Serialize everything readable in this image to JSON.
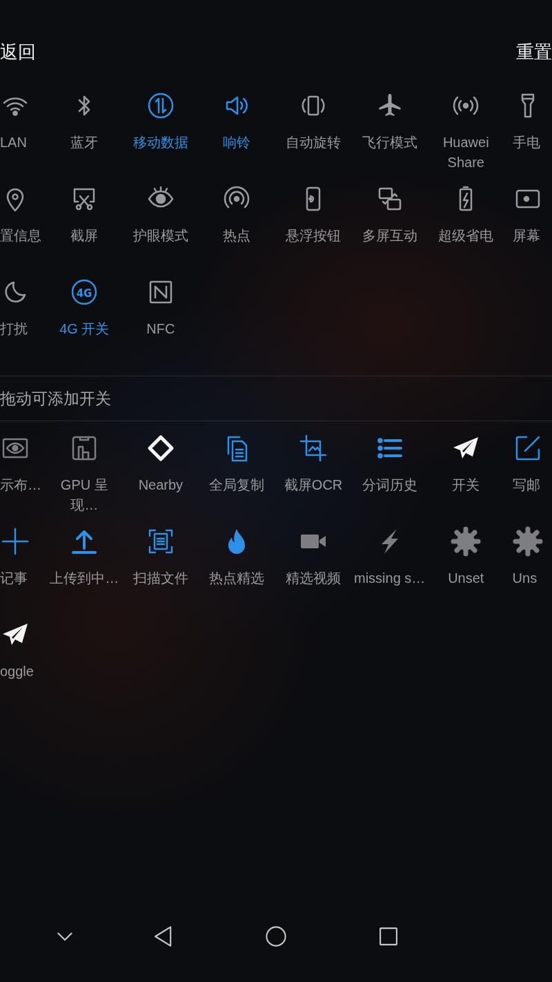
{
  "header": {
    "back": "返回",
    "reset": "重置"
  },
  "active_tiles": [
    {
      "label": "LAN",
      "active": false
    },
    {
      "label": "蓝牙",
      "active": false
    },
    {
      "label": "移动数据",
      "active": true
    },
    {
      "label": "响铃",
      "active": true
    },
    {
      "label": "自动旋转",
      "active": false
    },
    {
      "label": "飞行模式",
      "active": false
    },
    {
      "label": "Huawei Share",
      "active": false
    },
    {
      "label": "手电",
      "active": false
    },
    {
      "label": "置信息",
      "active": false
    },
    {
      "label": "截屏",
      "active": false
    },
    {
      "label": "护眼模式",
      "active": false
    },
    {
      "label": "热点",
      "active": false
    },
    {
      "label": "悬浮按钮",
      "active": false
    },
    {
      "label": "多屏互动",
      "active": false
    },
    {
      "label": "超级省电",
      "active": false
    },
    {
      "label": "屏幕",
      "active": false
    },
    {
      "label": "打扰",
      "active": false
    },
    {
      "label": "4G 开关",
      "active": true,
      "badge": "4G"
    },
    {
      "label": "NFC",
      "active": false
    }
  ],
  "add_hint": "拖动可添加开关",
  "available_tiles": [
    {
      "label": "示布…"
    },
    {
      "label": "GPU 呈现…"
    },
    {
      "label": "Nearby"
    },
    {
      "label": "全局复制"
    },
    {
      "label": "截屏OCR"
    },
    {
      "label": "分词历史"
    },
    {
      "label": "开关"
    },
    {
      "label": "写邮"
    },
    {
      "label": "记事"
    },
    {
      "label": "上传到中…"
    },
    {
      "label": "扫描文件"
    },
    {
      "label": "热点精选"
    },
    {
      "label": "精选视频"
    },
    {
      "label": "missing s…"
    },
    {
      "label": "Unset"
    },
    {
      "label": "Uns"
    },
    {
      "label": "oggle"
    }
  ]
}
